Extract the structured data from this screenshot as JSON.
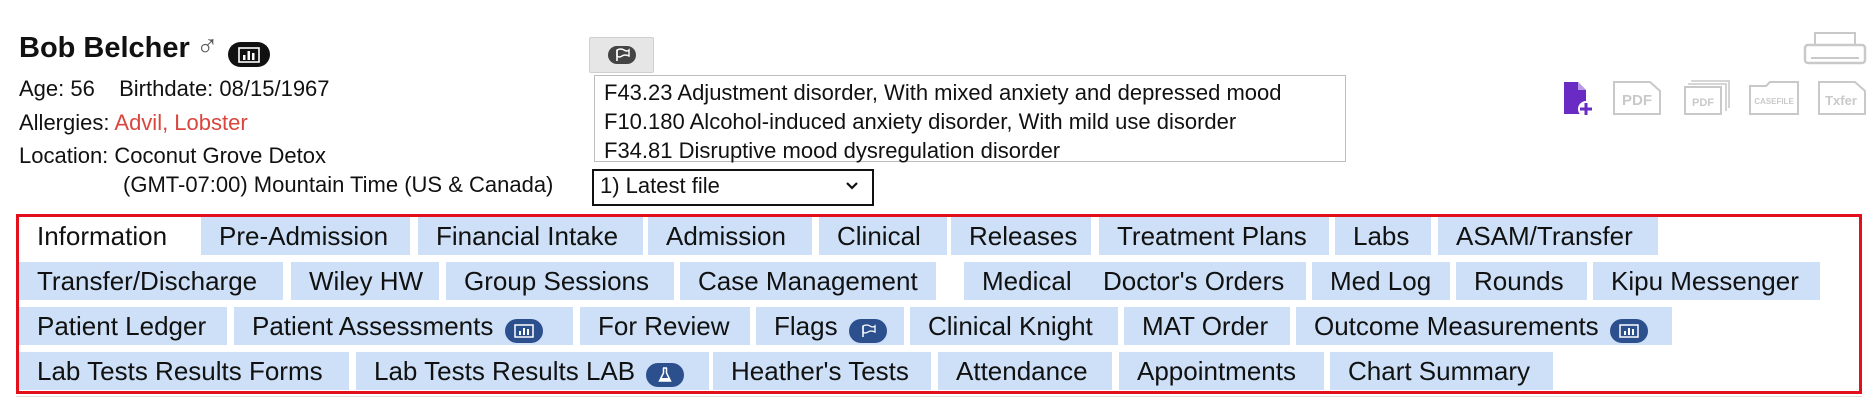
{
  "patient": {
    "name": "Bob Belcher",
    "gender_icon": "male-icon",
    "gender_symbol": "♂",
    "age_label": "Age:",
    "age": "56",
    "birthdate_label": "Birthdate:",
    "birthdate": "08/15/1967",
    "allergies_label": "Allergies:",
    "allergies": "Advil, Lobster",
    "location_label": "Location:",
    "location": "Coconut Grove Detox",
    "timezone": "(GMT-07:00) Mountain Time (US & Canada)"
  },
  "diagnoses": [
    "F43.23 Adjustment disorder, With mixed anxiety and depressed mood",
    "F10.180 Alcohol-induced anxiety disorder, With mild use disorder",
    "F34.81 Disruptive mood dysregulation disorder"
  ],
  "file_select": {
    "selected": "1) Latest file"
  },
  "doc_icons": [
    {
      "name": "new-document-icon",
      "label": "",
      "color": "#6a2bc4"
    },
    {
      "name": "pdf-icon",
      "label": "PDF",
      "color": "#c9c9c9"
    },
    {
      "name": "multi-pdf-icon",
      "label": "PDF",
      "color": "#c9c9c9"
    },
    {
      "name": "casefile-icon",
      "label": "CASEFILE",
      "color": "#c9c9c9"
    },
    {
      "name": "txfer-icon",
      "label": "Txfer",
      "color": "#c9c9c9"
    }
  ],
  "tabs": [
    {
      "label": "Information",
      "active": true
    },
    {
      "label": "Pre-Admission"
    },
    {
      "label": "Financial Intake"
    },
    {
      "label": "Admission"
    },
    {
      "label": "Clinical"
    },
    {
      "label": "Releases"
    },
    {
      "label": "Treatment Plans"
    },
    {
      "label": "Labs"
    },
    {
      "label": "ASAM/Transfer"
    },
    {
      "label": "Transfer/Discharge"
    },
    {
      "label": "Wiley HW"
    },
    {
      "label": "Group Sessions"
    },
    {
      "label": "Case Management"
    },
    {
      "label": "Medical"
    },
    {
      "label": "Doctor's Orders"
    },
    {
      "label": "Med Log"
    },
    {
      "label": "Rounds"
    },
    {
      "label": "Kipu Messenger"
    },
    {
      "label": "Patient Ledger"
    },
    {
      "label": "Patient Assessments",
      "badge_icon": "chart-icon"
    },
    {
      "label": "For Review"
    },
    {
      "label": "Flags",
      "badge_icon": "flag-icon"
    },
    {
      "label": "Clinical Knight"
    },
    {
      "label": "MAT Order"
    },
    {
      "label": "Outcome Measurements",
      "badge_icon": "chart-icon"
    },
    {
      "label": "Lab Tests Results Forms"
    },
    {
      "label": "Lab Tests Results LAB",
      "badge_icon": "flask-icon"
    },
    {
      "label": "Heather's Tests"
    },
    {
      "label": "Attendance"
    },
    {
      "label": "Appointments"
    },
    {
      "label": "Chart Summary"
    }
  ],
  "colors": {
    "tab_background": "#cde0f7",
    "highlight_border": "#e3101c",
    "allergy_text": "#d9463e",
    "badge": "#2c4f8e"
  }
}
